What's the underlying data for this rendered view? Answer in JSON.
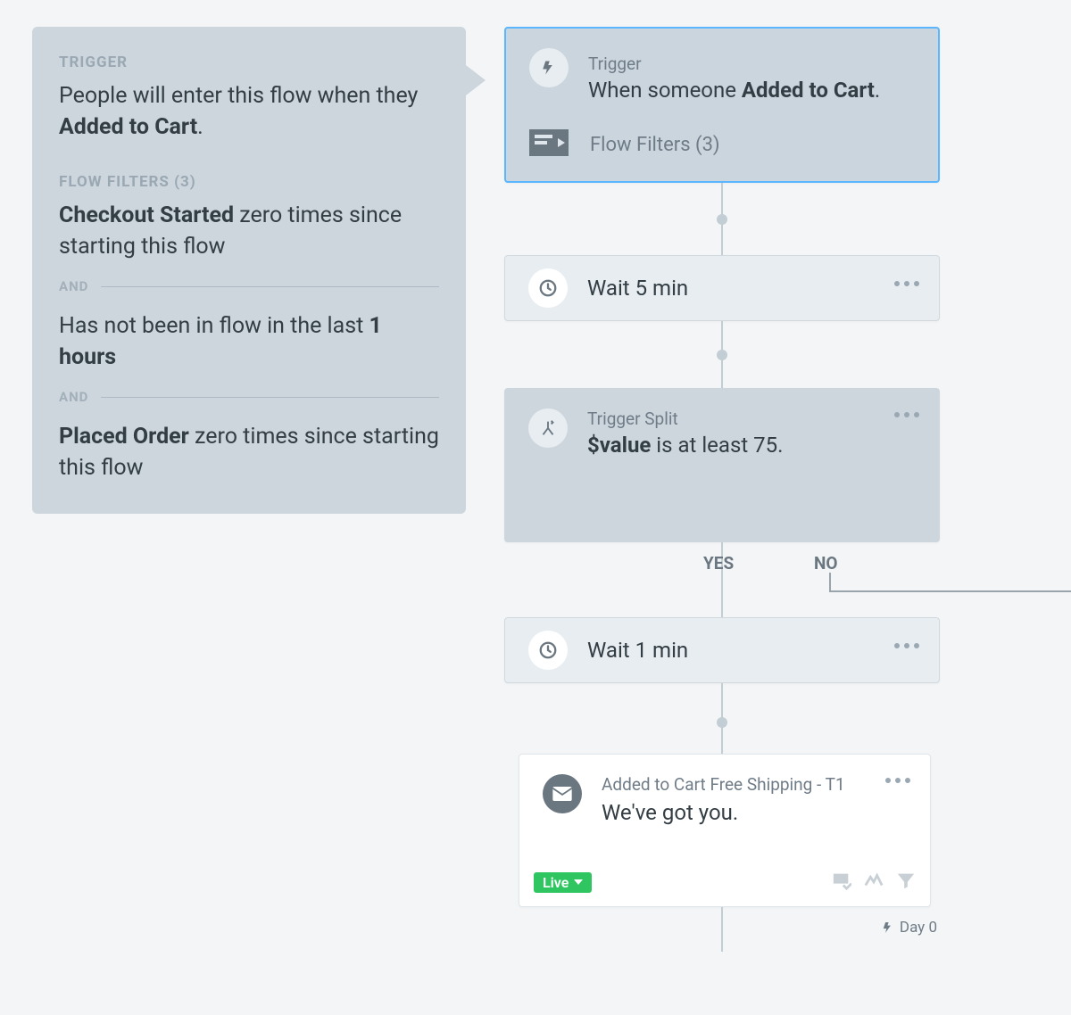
{
  "panel": {
    "trigger_label": "TRIGGER",
    "trigger_prefix": "People will enter this flow when they ",
    "trigger_event": "Added to Cart",
    "filters_label": "FLOW FILTERS (3)",
    "filter1_bold": "Checkout Started",
    "filter1_rest": " zero times since starting this flow",
    "and": "AND",
    "filter2_prefix": "Has not been in flow in the last ",
    "filter2_bold": "1 hours",
    "filter3_bold": "Placed Order",
    "filter3_rest": " zero times since starting this flow"
  },
  "trigger_card": {
    "label": "Trigger",
    "prefix": "When someone ",
    "event": "Added to Cart",
    "filters": "Flow Filters (3)"
  },
  "wait1": {
    "text": "Wait 5 min"
  },
  "split": {
    "label": "Trigger Split",
    "var": "$value",
    "rest": " is at least 75."
  },
  "branch": {
    "yes": "YES",
    "no": "NO"
  },
  "wait2": {
    "text": "Wait 1 min"
  },
  "email": {
    "name": "Added to Cart Free Shipping - T1",
    "subject": "We've got you.",
    "status": "Live"
  },
  "day": "Day 0"
}
